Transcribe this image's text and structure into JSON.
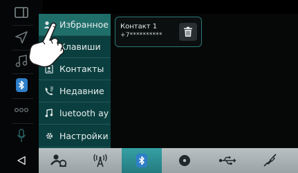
{
  "menu": {
    "items": [
      {
        "label": "Избранное",
        "icon": "favorites-contact-icon",
        "active": true
      },
      {
        "label": "Клавиши",
        "icon": "keypad-icon",
        "active": false
      },
      {
        "label": "Контакты",
        "icon": "contacts-book-icon",
        "active": false
      },
      {
        "label": "Недавние",
        "icon": "recent-calls-icon",
        "active": false
      },
      {
        "label": "luetooth ay",
        "icon": "music-note-icon",
        "active": false
      },
      {
        "label": "Настройки",
        "icon": "gear-icon",
        "active": false
      }
    ]
  },
  "favorites": {
    "contacts": [
      {
        "name": "Контакт 1",
        "number": "+7**********"
      }
    ]
  },
  "rail": {
    "icons": [
      "split-screen-icon",
      "navigation-arrow-icon",
      "music-note-icon",
      "bluetooth-icon",
      "more-dots-icon",
      "microphone-icon",
      "back-triangle-icon"
    ],
    "active": "bluetooth-icon"
  },
  "tabbar": {
    "icons": [
      "user-steering-icon",
      "radio-antenna-icon",
      "bluetooth-icon",
      "disc-icon",
      "usb-icon",
      "aux-plug-icon"
    ],
    "active": "bluetooth-icon"
  },
  "colors": {
    "menu_bg": "#0b3f3f",
    "menu_active": "#1f6e6a",
    "card_border": "#2d7878",
    "tab_active": "#2c8f93",
    "bluetooth_badge": "#2f7fc8"
  }
}
